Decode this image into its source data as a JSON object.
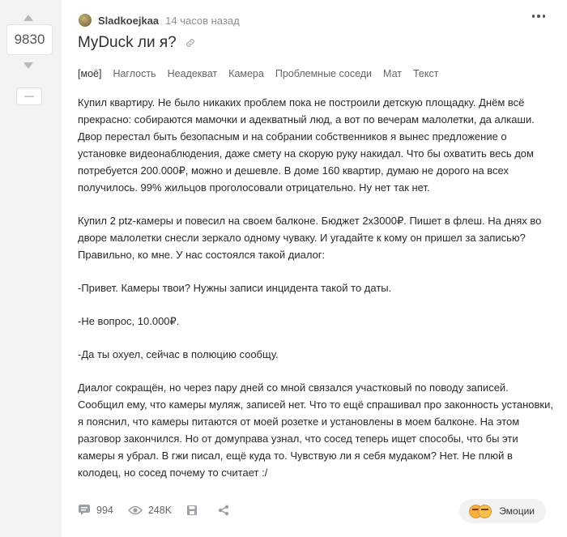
{
  "rating": {
    "score": "9830",
    "minus_label": "—"
  },
  "post": {
    "author": "Sladkoejkaa",
    "time": "14 часов назад",
    "title": "MyDuck ли я?",
    "tags": [
      "[моё]",
      "Наглость",
      "Неадекват",
      "Камера",
      "Проблемные соседи",
      "Мат",
      "Текст"
    ],
    "paragraphs": [
      "Купил квартиру. Не было никаких проблем пока не построили детскую площадку. Днём всё прекрасно: собираются мамочки и адекватный люд, а вот по вечерам малолетки, да алкаши. Двор перестал быть безопасным и на собрании собственников я вынес предложение о установке видеонаблюдения, даже смету на скорую руку накидал. Что бы охватить весь дом потребуется 200.000₽, можно и дешевле. В доме 160 квартир, думаю не дорого на всех получилось. 99% жильцов проголосовали отрицательно. Ну нет так нет.",
      "Купил 2 ptz-камеры и повесил на своем балконе. Бюджет 2х3000₽. Пишет в флеш. На днях во дворе малолетки снесли зеркало одному чуваку. И угадайте к кому он пришел за записью? Правильно, ко мне. У нас состоялся такой диалог:",
      "-Привет. Камеры твои? Нужны записи инцидента такой то даты.",
      "-Не вопрос, 10.000₽.",
      "-Да ты охуел, сейчас в полюцию сообщу.",
      "Диалог сокращён, но через пару дней со мной связался участковый по поводу записей. Сообщил ему, что камеры муляж, записей нет. Что то ещё спрашивал про законность установки, я пояснил, что камеры питаются от моей розетке и установлены в моем балконе. На этом разговор закончился. Но от домуправа узнал, что сосед теперь ищет способы, что бы эти камеры я убрал. В гжи писал, ещё куда то. Чувствую ли я себя мудаком? Нет. Не плюй в колодец, но сосед почему то считает :/"
    ]
  },
  "footer": {
    "comments": "994",
    "views": "248K",
    "emotions_label": "Эмоции"
  }
}
